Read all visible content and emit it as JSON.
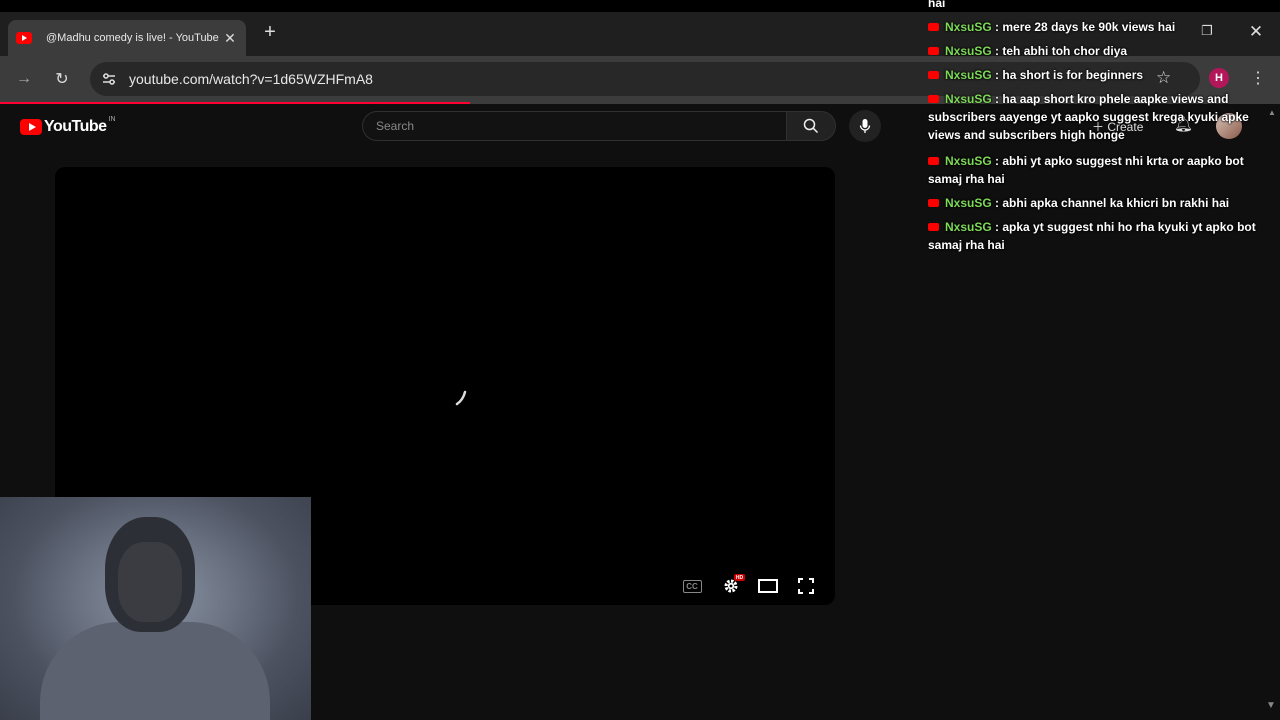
{
  "browser": {
    "tab": {
      "title": "@Madhu comedy is live! - YouTube"
    },
    "url": "youtube.com/watch?v=1d65WZHFmA8",
    "profile_initial": "H"
  },
  "youtube": {
    "logo_text": "YouTube",
    "country": "IN",
    "search_placeholder": "Search",
    "create_label": "Create"
  },
  "player": {
    "cc_label": "CC",
    "hd_badge": "HD"
  },
  "chat": {
    "top_fragment": "hai",
    "messages": [
      {
        "user": "NxsuSG",
        "text": "mere 28 days ke 90k views hai"
      },
      {
        "user": "NxsuSG",
        "text": "teh abhi toh chor diya"
      },
      {
        "user": "NxsuSG",
        "text": "ha short is for beginners"
      },
      {
        "user": "NxsuSG",
        "text": "ha aap short kro phele aapke views and subscribers aayenge yt aapko suggest krega kyuki apke views and subscribers high honge"
      },
      {
        "user": "NxsuSG",
        "text": "abhi yt apko suggest nhi krta or aapko bot samaj rha hai"
      },
      {
        "user": "NxsuSG",
        "text": "abhi apka channel ka khicri bn rakhi hai"
      },
      {
        "user": "NxsuSG",
        "text": "apka yt suggest nhi ho rha kyuki yt apko bot samaj rha hai"
      }
    ]
  }
}
